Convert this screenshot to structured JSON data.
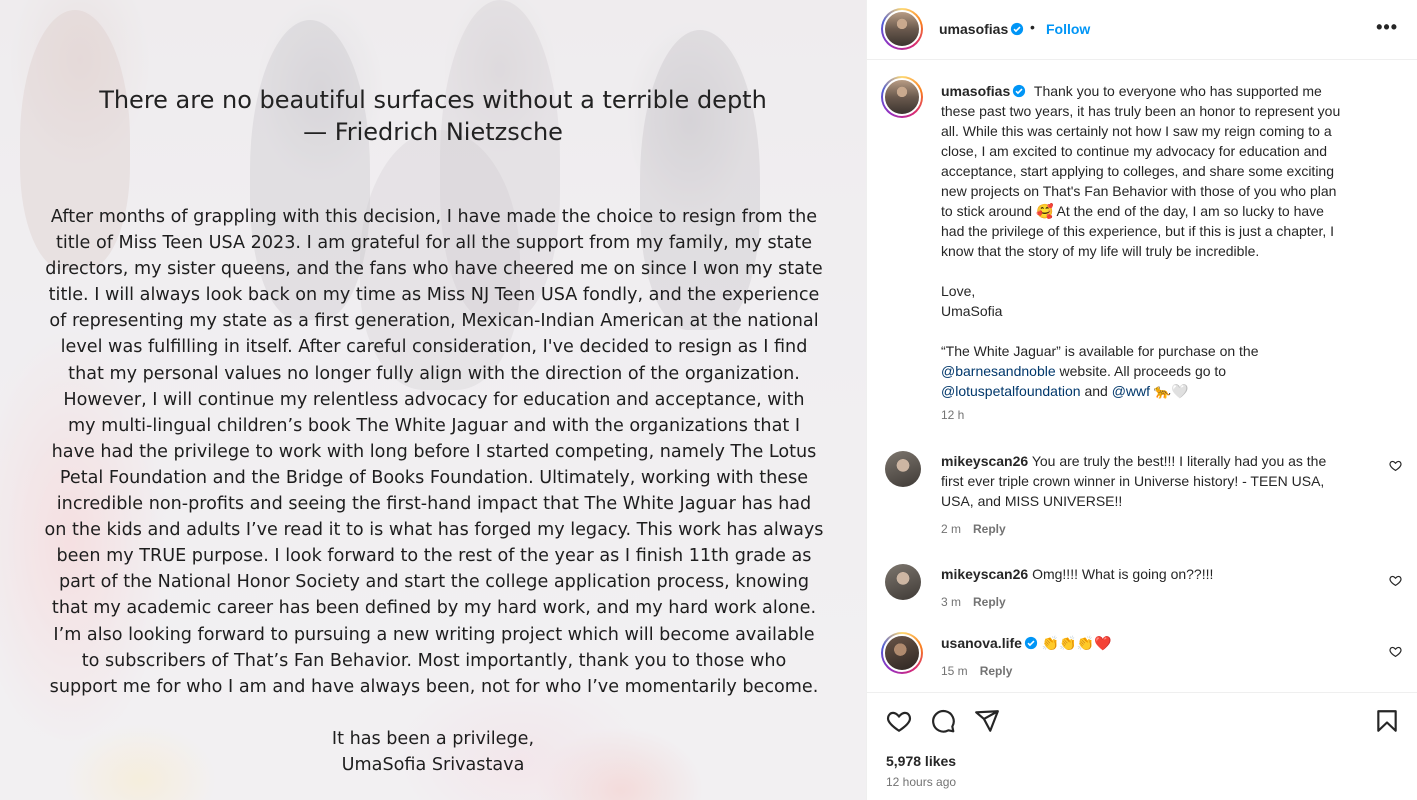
{
  "post": {
    "quote_line1": "There are no beautiful surfaces without a terrible depth",
    "quote_line2": "— Friedrich Nietzsche",
    "letter_lines": [
      "After months of grappling with this decision, I have made the choice to resign from the",
      "title of Miss Teen USA 2023. I am grateful for all the support from my family, my state",
      "directors, my sister queens, and the fans who have cheered me on since I won my state",
      "title. I will always look back on my time as Miss NJ Teen USA fondly, and the experience",
      "of representing my state as a first generation, Mexican-Indian American at the national",
      "level was fulfilling in itself. After careful consideration, I've decided to resign as I find",
      "that my personal values no longer fully align with the direction of the organization.",
      "However, I will continue my relentless advocacy for education and acceptance, with",
      "my multi-lingual children’s book The White Jaguar and with the organizations that I",
      "have had the privilege to work with long before I started competing, namely The Lotus",
      "Petal Foundation and the Bridge of Books Foundation. Ultimately, working with these",
      "incredible non-profits and seeing the first-hand impact that The White Jaguar has had",
      "on the kids and adults I’ve read it to is what has forged my legacy. This work has always",
      "been my TRUE purpose. I look forward to the rest of the year as I finish 11th grade as",
      "part of the National Honor Society and start the college application process, knowing",
      "that my academic career has been defined by my hard work, and my hard work alone.",
      "I’m also looking forward to pursuing a new writing project which will become available",
      "to subscribers of That’s Fan Behavior. Most importantly, thank you to those who",
      "support me for who I am and have always been, not for who I’ve momentarily become."
    ],
    "signoff_line1": "It has been a privilege,",
    "signoff_line2": "UmaSofia Srivastava"
  },
  "header": {
    "username": "umasofias",
    "dot": "•",
    "follow_label": "Follow",
    "more_label": "•••"
  },
  "caption": {
    "username": "umasofias",
    "line1": "Thank you to everyone who has supported me",
    "lines": [
      "these past two years, it has truly been an honor to represent you",
      "all. While this was certainly not how I saw my reign coming to a",
      "close, I am excited to continue my advocacy for education and",
      "acceptance, start applying to colleges, and share some exciting",
      "new projects on That's Fan Behavior with those of you who plan"
    ],
    "line7_a": "to stick around",
    "emoji_smile": "🥰",
    "line7_b": "At the end of the day, I am so lucky to have",
    "lines_b": [
      "had the privilege of this experience, but if this is just a chapter, I",
      "know that the story of my life will truly be incredible."
    ],
    "love": "Love,",
    "signature": "UmaSofia",
    "book_line": "“The White Jaguar” is available for purchase on the",
    "mention_bn": "@barnesandnoble",
    "bn_rest": "website. All proceeds go to",
    "mention_lotus": "@lotuspetalfoundation",
    "and": "and",
    "mention_wwf": "@wwf",
    "emoji_leopard": "🐆",
    "emoji_heart": "🤍",
    "time": "12 h"
  },
  "comments": [
    {
      "username": "mikeyscan26",
      "lines": [
        "You are truly the best!!! I literally had you as the",
        "first ever triple crown winner in Universe history! - TEEN USA,",
        "USA, and MISS UNIVERSE!!"
      ],
      "time": "2 m",
      "reply": "Reply"
    },
    {
      "username": "mikeyscan26",
      "lines": [
        "Omg!!!! What is going on??!!!"
      ],
      "time": "3 m",
      "reply": "Reply"
    },
    {
      "username": "usanova.life",
      "lines": [
        "👏👏👏❤️"
      ],
      "time": "15 m",
      "reply": "Reply"
    }
  ],
  "footer": {
    "likes": "5,978 likes",
    "posted": "12 hours ago"
  },
  "colors": {
    "link_blue": "#0095f6",
    "mention_blue": "#00376b",
    "verified_blue": "#0095f6",
    "muted": "#737373"
  },
  "icons": [
    "verified-badge-icon",
    "more-options-icon",
    "heart-icon",
    "comment-icon",
    "share-icon",
    "bookmark-icon"
  ]
}
